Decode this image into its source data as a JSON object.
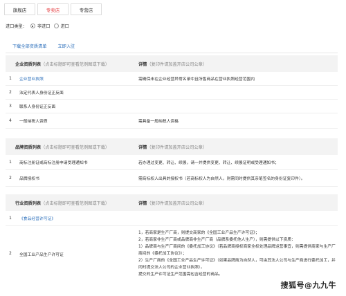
{
  "tabs": [
    "旗舰店",
    "专卖店",
    "专营店"
  ],
  "import_type": {
    "label": "进口类型",
    "options": [
      "非进口",
      "进口"
    ],
    "selected": 0
  },
  "links": {
    "download": "下载全部资质清单",
    "apply": "立即入驻"
  },
  "sections": [
    {
      "title": "企业资质列表",
      "hint": "（点击标题即可查看范例图或下载）",
      "detail_title": "详情",
      "detail_hint": "（复印件请加盖开店公司公章）",
      "rows": [
        {
          "num": "1",
          "name": "企业营业执照",
          "detail": "需确保未在企业经营异常名录中且所售商品在营业执照经营范围内"
        },
        {
          "num": "2",
          "name": "法定代表人身份证正反面",
          "detail": ""
        },
        {
          "num": "3",
          "name": "联系人身份证正反面",
          "detail": ""
        },
        {
          "num": "4",
          "name": "一般纳税人资质",
          "detail": "需具备一般纳税人资格"
        }
      ]
    },
    {
      "title": "品牌资质列表",
      "hint": "（点击标题即可查看范例图或下载）",
      "detail_title": "详情",
      "detail_hint": "（复印件请加盖开店公司公章）",
      "rows": [
        {
          "num": "1",
          "name": "商标注册证或商标注册申请受理通知书",
          "detail": "若办理过变更、转让、续展，请一并提供变更、转让、续展证明或受理通知书；"
        },
        {
          "num": "2",
          "name": "品牌授权书",
          "detail": "需商标权人出具的授权书（若商标权人为自然人，则需同时提供其亲笔签名的身份证复印件）。"
        }
      ]
    },
    {
      "title": "行业资质列表",
      "hint": "（点击标题即可查看范例图或下载）",
      "detail_title": "详情",
      "detail_hint": "（复印件请加盖开店公司公章）",
      "rows": [
        {
          "num": "1",
          "name": "《食品经营许可证》",
          "detail": ""
        },
        {
          "num": "2",
          "name": "全国工业产品生产许可证",
          "detail_lines": [
            "1，若商家是生产厂商，则提交商家的《全国工业产品生产许可证》；",
            "2，若商家非生产厂商或品牌商非生产厂商（品牌系委托他人生产），则需提供以下资质：",
            "1）品牌商与生产厂商间的《委托加工协议》（若品牌商授权商家全权处理品牌运营事宜，则需提供商家与生产厂商间的《委托加工协议》）；",
            "2）生产厂商的《全国工业产品生产许可证》（如果品牌商为自然人，可由其法人公司与生产商进行委托加工，并同时提交法人公司的企业营业执照）。",
            "提交的生产许可证生产范围需包含经营的商品。"
          ]
        }
      ]
    }
  ],
  "watermark": "搜狐号@九九牛"
}
